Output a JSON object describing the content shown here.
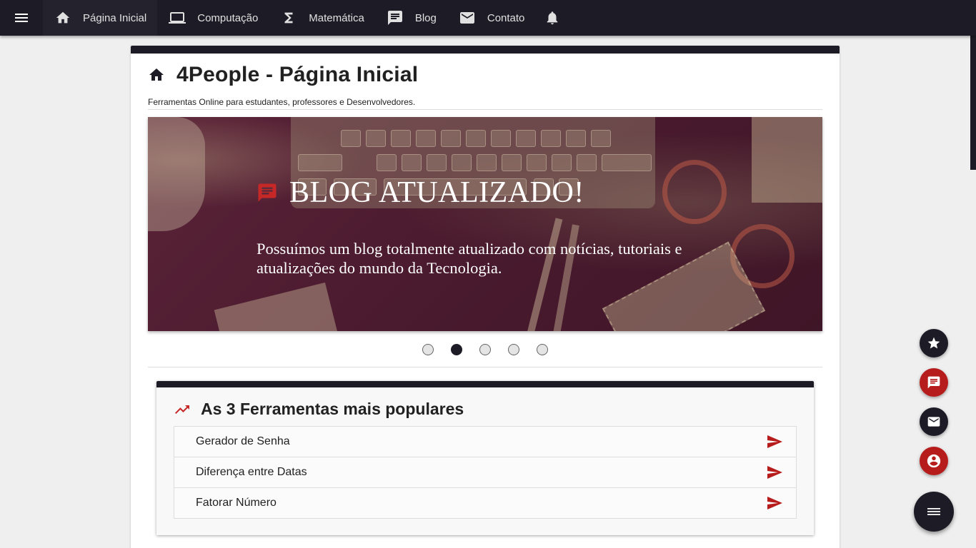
{
  "nav": {
    "items": [
      {
        "label": "Página Inicial",
        "icon": "home-icon"
      },
      {
        "label": "Computação",
        "icon": "laptop-icon"
      },
      {
        "label": "Matemática",
        "icon": "sigma-icon"
      },
      {
        "label": "Blog",
        "icon": "comment-icon"
      },
      {
        "label": "Contato",
        "icon": "mail-icon"
      }
    ],
    "active_index": 0
  },
  "page": {
    "title": "4People - Página Inicial",
    "subtitle": "Ferramentas Online para estudantes, professores e Desenvolvedores."
  },
  "carousel": {
    "slide": {
      "title": "BLOG ATUALIZADO!",
      "description": "Possuímos um blog totalmente atualizado com notícias, tutoriais e atualizações do mundo da Tecnologia."
    },
    "slide_count": 5,
    "active_slide": 2
  },
  "popular": {
    "title": "As 3 Ferramentas mais populares",
    "items": [
      {
        "label": "Gerador de Senha"
      },
      {
        "label": "Diferença entre Datas"
      },
      {
        "label": "Fatorar Número"
      }
    ]
  },
  "fabs": [
    {
      "icon": "star-icon",
      "color": "#1d1c26"
    },
    {
      "icon": "comment-icon",
      "color": "#b71c1c"
    },
    {
      "icon": "mail-icon",
      "color": "#1d1c26"
    },
    {
      "icon": "account-icon",
      "color": "#b71c1c"
    }
  ],
  "colors": {
    "primary": "#1d1c26",
    "accent": "#b71c1c"
  }
}
